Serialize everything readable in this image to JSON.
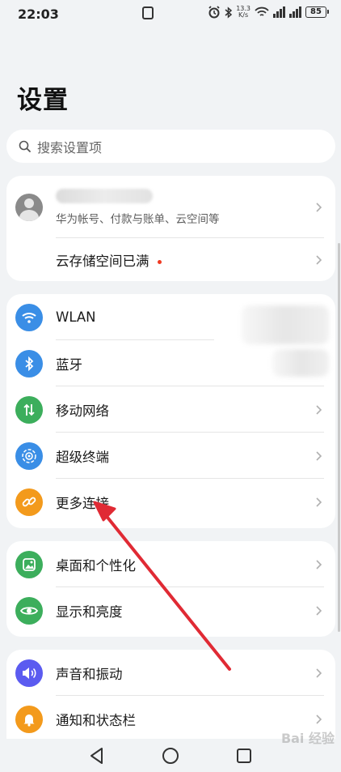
{
  "status_bar": {
    "time": "22:03",
    "net_speed_value": "13.3",
    "net_speed_unit": "K/s",
    "battery": "85"
  },
  "page_title": "设置",
  "search": {
    "placeholder": "搜索设置项"
  },
  "account": {
    "subtitle": "华为帐号、付款与账单、云空间等",
    "cloud_label": "云存储空间已满"
  },
  "connect_items": [
    {
      "label": "WLAN",
      "icon": "wifi-icon",
      "color": "#3a8ee6"
    },
    {
      "label": "蓝牙",
      "icon": "bluetooth-icon",
      "color": "#3a8ee6"
    },
    {
      "label": "移动网络",
      "icon": "mobile-network-icon",
      "color": "#3cae5c"
    },
    {
      "label": "超级终端",
      "icon": "super-device-icon",
      "color": "#3a8ee6"
    },
    {
      "label": "更多连接",
      "icon": "link-icon",
      "color": "#f39a1c"
    }
  ],
  "display_items": [
    {
      "label": "桌面和个性化",
      "icon": "wallpaper-icon",
      "color": "#3cae5c"
    },
    {
      "label": "显示和亮度",
      "icon": "eye-icon",
      "color": "#3cae5c"
    }
  ],
  "sound_items": [
    {
      "label": "声音和振动",
      "icon": "speaker-icon",
      "color": "#5b5bf0"
    },
    {
      "label": "通知和状态栏",
      "icon": "bell-icon",
      "color": "#f39a1c"
    }
  ],
  "annotation": {
    "arrow_color": "#e02a34"
  },
  "watermark": "Bai 经验"
}
